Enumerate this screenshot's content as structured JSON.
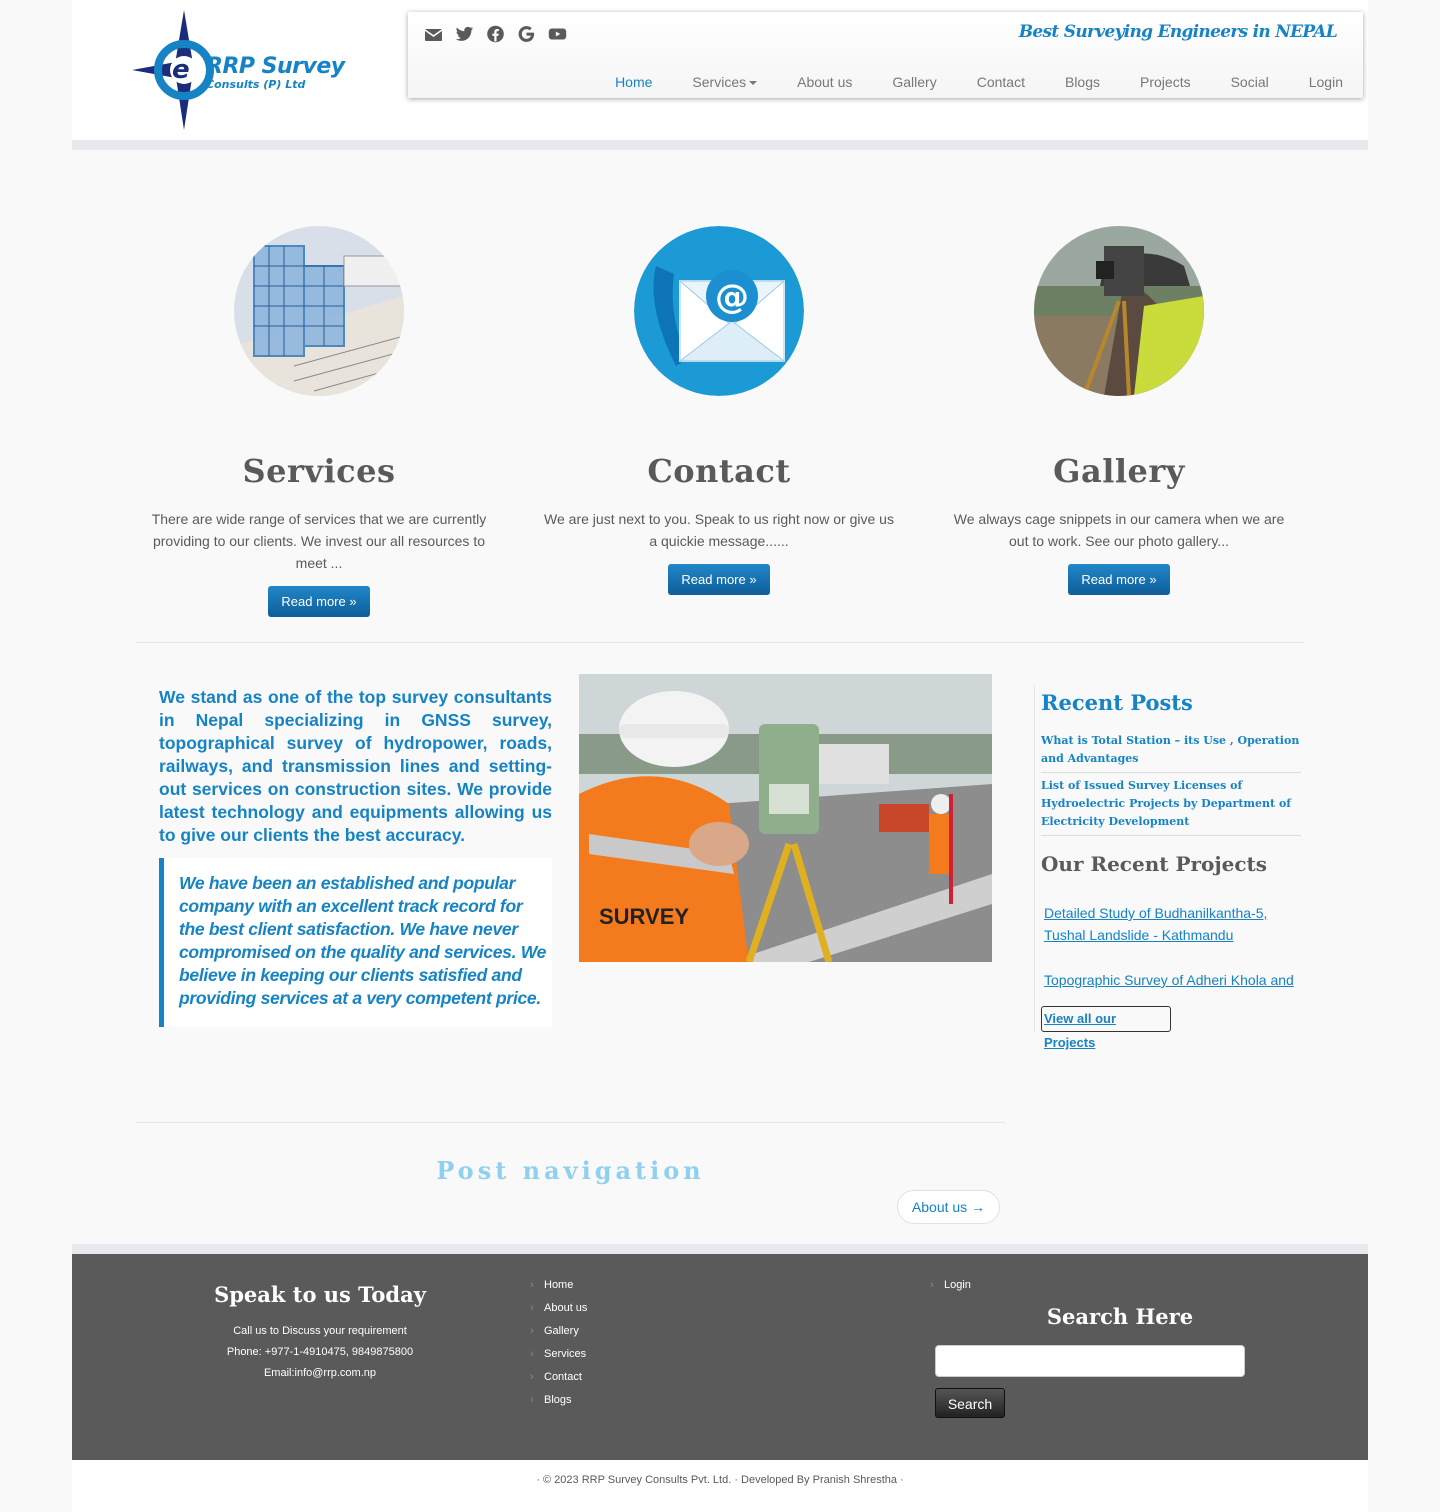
{
  "header": {
    "logo_text": "RRP Survey",
    "logo_subtext": "Consults (P) Ltd",
    "tagline": "Best Surveying Engineers in NEPAL",
    "social_icons": [
      "envelope-icon",
      "twitter-icon",
      "facebook-icon",
      "google-icon",
      "youtube-icon"
    ],
    "menu": [
      "Home",
      "Services",
      "About us",
      "Gallery",
      "Contact",
      "Blogs",
      "Projects",
      "Social",
      "Login"
    ]
  },
  "featured": [
    {
      "title": "Services",
      "text": "There are wide range of services that we are currently providing to our clients. We invest our all resources to meet ...",
      "button": "Read more »"
    },
    {
      "title": "Contact",
      "text": "We are just next to you. Speak to us right now or give us a quickie message......",
      "button": "Read more »"
    },
    {
      "title": "Gallery",
      "text": "We always cage snippets in our camera when we are out to work. See our photo gallery...",
      "button": "Read more »"
    }
  ],
  "main": {
    "intro": "We stand as one of the top survey consultants in Nepal specializing in GNSS survey, topographical survey of hydropower, roads, railways, and transmission lines and setting-out services on construction sites. We provide latest technology and equipments allowing us to give our clients the best accuracy.",
    "quote": "We have been an established and popular company with an excellent track record for the best client satisfaction. We have never compromised on the quality and services. We believe in keeping our clients satisfied and providing services at a very competent price."
  },
  "sidebar": {
    "recent_posts_title": "Recent Posts",
    "posts": [
      "What is Total Station – its Use , Operation and Advantages",
      "List of Issued Survey Licenses of Hydroelectric Projects by Department of Electricity Development"
    ],
    "projects_title": "Our Recent Projects",
    "projects": [
      "Detailed Study of Budhanilkantha-5, Tushal Landslide - Kathmandu",
      "Topographic Survey of Adheri Khola and"
    ],
    "view_all": "View all our Projects"
  },
  "post_navigation": {
    "title": "Post navigation",
    "next": "About us →"
  },
  "footer": {
    "contact_title": "Speak to us Today",
    "contact_lines": [
      "Call us to Discuss your requirement",
      "Phone: +977-1-4910475, 9849875800",
      "Email:info@rrp.com.np"
    ],
    "links": [
      "Home",
      "About us",
      "Gallery",
      "Services",
      "Contact",
      "Blogs"
    ],
    "links_right": [
      "Login"
    ],
    "search_title": "Search Here",
    "search_button": "Search",
    "search_placeholder": ""
  },
  "colophon": "· © 2023 RRP Survey Consults Pvt. Ltd. · Developed By Pranish Shrestha ·",
  "colors": {
    "accent": "#1583c4",
    "footer_bg": "#5a5a5a",
    "page_bg": "#f9f9f9"
  }
}
